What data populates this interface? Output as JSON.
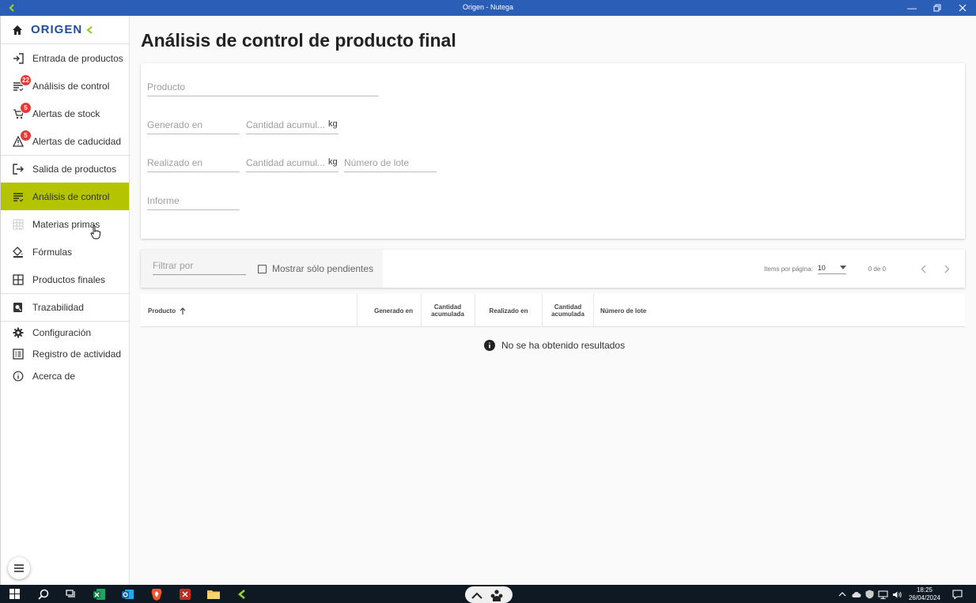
{
  "window": {
    "title": "Origen - Nutega"
  },
  "brand": {
    "name": "ORIGEN"
  },
  "sidebar": {
    "items": [
      {
        "label": "Entrada de productos",
        "icon": "login-icon"
      },
      {
        "label": "Análisis de control",
        "icon": "list-check-icon",
        "badge": "22"
      },
      {
        "label": "Alertas de stock",
        "icon": "cart-icon",
        "badge": "5"
      },
      {
        "label": "Alertas de caducidad",
        "icon": "warning-icon",
        "badge": "5"
      },
      {
        "label": "Salida de productos",
        "icon": "logout-icon"
      },
      {
        "label": "Análisis de control",
        "icon": "list-check-icon",
        "active": true
      },
      {
        "label": "Materias primas",
        "icon": "grid-dots-icon"
      },
      {
        "label": "Fórmulas",
        "icon": "paint-bucket-icon"
      },
      {
        "label": "Productos finales",
        "icon": "grid-icon"
      },
      {
        "label": "Trazabilidad",
        "icon": "search-doc-icon"
      },
      {
        "label": "Configuración",
        "icon": "gear-icon"
      },
      {
        "label": "Registro de actividad",
        "icon": "list-alt-icon"
      },
      {
        "label": "Acerca de",
        "icon": "info-icon"
      }
    ]
  },
  "main": {
    "title": "Análisis de control de producto final",
    "form": {
      "producto_placeholder": "Producto",
      "generado_en_placeholder": "Generado en",
      "cantidad1_placeholder": "Cantidad acumul...",
      "unit": "kg",
      "realizado_en_placeholder": "Realizado en",
      "cantidad2_placeholder": "Cantidad acumul...",
      "numero_lote_placeholder": "Número de lote",
      "informe_placeholder": "Informe"
    },
    "filter": {
      "placeholder": "Filtrar por",
      "checkbox_label": "Mostrar sólo pendientes"
    },
    "paginator": {
      "items_label": "Items por página:",
      "page_size": "10",
      "range": "0 de 0"
    },
    "table": {
      "columns": [
        "Producto",
        "Generado en",
        "Cantidad acumulada",
        "Realizado en",
        "Cantidad acumulada",
        "Número de lote"
      ]
    },
    "empty_message": "No se ha obtenido resultados"
  },
  "taskbar": {
    "time": "18:25",
    "date": "26/04/2024"
  },
  "colors": {
    "titlebar": "#2b5fb7",
    "accent": "#b5c400",
    "brand": "#1f4e9c",
    "badge": "#e53935"
  }
}
